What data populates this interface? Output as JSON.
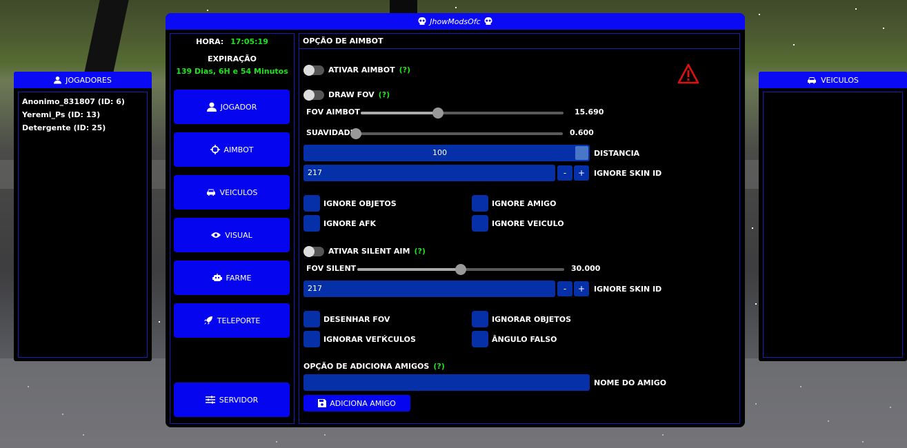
{
  "window": {
    "title": "JhowModsOfc"
  },
  "players_panel": {
    "title": "JOGADORES",
    "players": [
      "Anonimo_831807 (ID: 6)",
      "Yeremi_Ps (ID: 13)",
      "Detergente (ID: 25)"
    ]
  },
  "vehicles_panel": {
    "title": "VEICULOS"
  },
  "status": {
    "hora_label": "HORA:",
    "hora_value": "17:05:19",
    "expiracao_label": "EXPIRAÇÃO",
    "expiracao_value": "139 Dias, 6H e 54 Minutos"
  },
  "nav": [
    {
      "label": "JOGADOR",
      "icon": "user-icon"
    },
    {
      "label": "AIMBOT",
      "icon": "crosshair-icon"
    },
    {
      "label": "VEICULOS",
      "icon": "car-icon"
    },
    {
      "label": "VISUAL",
      "icon": "eye-icon"
    },
    {
      "label": "FARME",
      "icon": "robot-icon"
    },
    {
      "label": "TELEPORTE",
      "icon": "rocket-icon"
    },
    {
      "label": "SERVIDOR",
      "icon": "sliders-icon"
    }
  ],
  "aimbot": {
    "section_title": "OPÇÃO DE AIMBOT",
    "help_mark": "(?)",
    "ativar_aimbot": {
      "label": "ATIVAR AIMBOT",
      "enabled": false
    },
    "draw_fov": {
      "label": "DRAW FOV",
      "enabled": false
    },
    "fov_aimbot": {
      "label": "FOV AIMBOT",
      "value": "15.690",
      "fraction": 0.38
    },
    "suavidade": {
      "label": "SUAVIDADE",
      "value": "0.600",
      "fraction": 0.0
    },
    "distancia": {
      "label": "DISTANCIA",
      "value": "100"
    },
    "ignore_skin_1": {
      "label": "IGNORE SKIN ID",
      "value": "217",
      "minus": "-",
      "plus": "+"
    },
    "checks_1": {
      "ignore_objetos": "IGNORE OBJETOS",
      "ignore_amigo": "IGNORE AMIGO",
      "ignore_afk": "IGNORE AFK",
      "ignore_veiculo": "IGNORE VEICULO"
    },
    "silent_aim": {
      "label": "ATIVAR SILENT AIM",
      "enabled": false
    },
    "fov_silent": {
      "label": "FOV SILENT",
      "value": "30.000",
      "fraction": 0.5
    },
    "ignore_skin_2": {
      "label": "IGNORE SKIN ID",
      "value": "217",
      "minus": "-",
      "plus": "+"
    },
    "checks_2": {
      "desenhar_fov": "DESENHAR FOV",
      "ignorar_objetos": "IGNORAR OBJETOS",
      "ignorar_veiculos": "IGNORAR VEГЌCULOS",
      "angulo_falso": "ÂNGULO FALSO"
    },
    "amigos": {
      "section_label": "OPÇÃO DE ADICIONA AMIGOS",
      "nome_label": "NOME DO AMIGO",
      "nome_value": "",
      "button_label": "ADICIONA AMIGO"
    }
  }
}
